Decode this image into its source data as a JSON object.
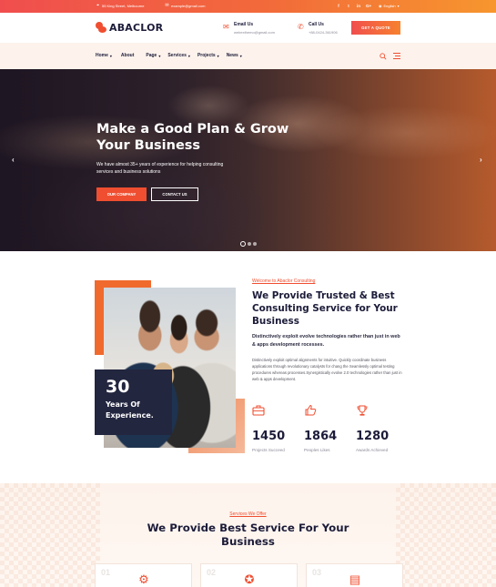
{
  "topbar": {
    "address": "55 King Street, Melbourne",
    "email": "example@gmail.com",
    "social": [
      "f",
      "t",
      "in",
      "G+"
    ],
    "language": "English"
  },
  "header": {
    "logo": "ABACLOR",
    "email_title": "Email Us",
    "email_value": "webexthemo@gmail.com",
    "call_title": "Call Us",
    "call_value": "+88-0424-361906",
    "quote_button": "GET A QUOTE"
  },
  "nav": {
    "items": [
      {
        "label": "Home",
        "dropdown": true
      },
      {
        "label": "About",
        "dropdown": false
      },
      {
        "label": "Page",
        "dropdown": true
      },
      {
        "label": "Services",
        "dropdown": true
      },
      {
        "label": "Projects",
        "dropdown": true
      },
      {
        "label": "News",
        "dropdown": true
      }
    ]
  },
  "hero": {
    "title": "Make a Good Plan & Grow Your Business",
    "text": "We have almost 35+ years of experience for helping consulting services and business solutions",
    "primary_button": "OUR COMPANY",
    "secondary_button": "CONTACT US",
    "slide_count": 3,
    "active_slide": 1
  },
  "about": {
    "tag": "Welcome to Abaclor Consulting",
    "title": "We Provide Trusted & Best Consulting Service for Your Business",
    "lead": "Distinctively exploit evolve technologies rather than just in web & apps development rocesses.",
    "body": "Distinctively exploit optimal alignments for intuitive. Quickly coordinate business applications through revolutionary catalysts for chang the Seamlessly optimal testing procedures whereas processes.Synergistically evolve 2.0 technologies rather than just in web & apps development.",
    "experience_number": "30",
    "experience_label": "Years Of Experience.",
    "stats": [
      {
        "icon": "briefcase-icon",
        "value": "1450",
        "label": "Projects Succeed"
      },
      {
        "icon": "thumbs-up-icon",
        "value": "1864",
        "label": "Peoples Likes"
      },
      {
        "icon": "trophy-icon",
        "value": "1280",
        "label": "Awards Achieved"
      }
    ]
  },
  "services": {
    "tag": "Services We Offer",
    "title": "We Provide Best Service For Your Business",
    "cards": [
      {
        "number": "01",
        "icon": "analytics-icon"
      },
      {
        "number": "02",
        "icon": "gear-people-icon"
      },
      {
        "number": "03",
        "icon": "chart-icon"
      }
    ]
  },
  "colors": {
    "accent": "#f04e30",
    "dark": "#1c1c3a",
    "nav_bg": "#fdf3ec"
  }
}
